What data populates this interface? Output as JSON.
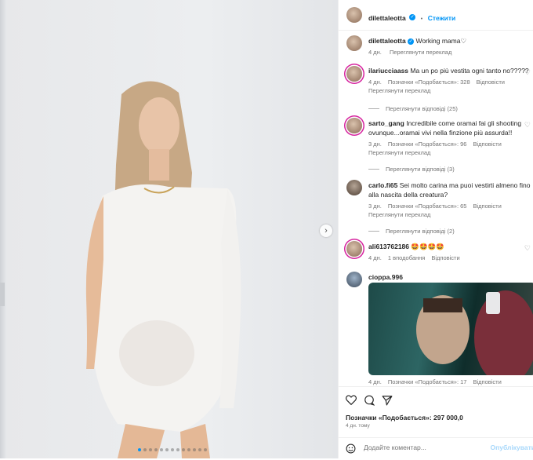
{
  "post": {
    "slide_count": 13,
    "active_slide": 1,
    "next_icon": "chevron-right"
  },
  "header": {
    "username": "dilettaleotta",
    "separator": "•",
    "follow_label": "Стежити",
    "more_icon": "more-icon"
  },
  "caption": {
    "username": "dilettaleotta",
    "text": "Working mama♡",
    "age": "4 дн.",
    "translate": "Переглянути переклад"
  },
  "comments": [
    {
      "username": "ilariucciaass",
      "text": "Ma un po più vestita ogni tanto no?????",
      "age": "4 дн.",
      "likes": "Позначки «Подобається»: 328",
      "reply": "Відповісти",
      "translate": "Переглянути переклад",
      "view_replies": "Переглянути відповіді (25)"
    },
    {
      "username": "sarto_gang",
      "text": "Incredibile come oramai fai gli shooting ovunque...oramai vivi nella finzione più assurda!!",
      "age": "3 дн.",
      "likes": "Позначки «Подобається»: 96",
      "reply": "Відповісти",
      "translate": "Переглянути переклад",
      "view_replies": "Переглянути відповіді (3)"
    },
    {
      "username": "carlo.fi65",
      "text": "Sei molto carina ma puoi vestirti almeno fino alla nascita della creatura?",
      "age": "3 дн.",
      "likes": "Позначки «Подобається»: 65",
      "reply": "Відповісти",
      "translate": "Переглянути переклад",
      "view_replies": "Переглянути відповіді (2)"
    },
    {
      "username": "ali613762186",
      "text": "🤩🤩🤩🤩",
      "age": "4 дн.",
      "likes": "1 вподобання",
      "reply": "Відповісти"
    },
    {
      "username": "cioppa.996",
      "text": "",
      "age": "4 дн.",
      "likes": "Позначки «Подобається»: 17",
      "reply": "Відповісти"
    }
  ],
  "footer": {
    "likes": "Позначки «Подобається»: 297 000,0",
    "age": "4 дн. тому",
    "comment_placeholder": "Додайте коментар...",
    "publish_label": "Опублікувати"
  },
  "colors": {
    "accent": "#0095f6",
    "muted": "#737373",
    "text": "#262626"
  }
}
